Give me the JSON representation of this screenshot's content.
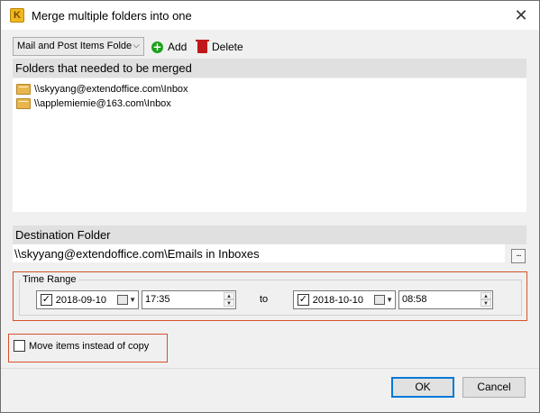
{
  "window": {
    "title": "Merge multiple folders into one"
  },
  "toolbar": {
    "folder_type_selected": "Mail and Post Items Folde",
    "add_label": "Add",
    "delete_label": "Delete"
  },
  "folders_section": {
    "heading": "Folders that needed to be merged",
    "items": [
      {
        "path": "\\\\skyyang@extendoffice.com\\Inbox"
      },
      {
        "path": "\\\\applemiemie@163.com\\Inbox"
      }
    ]
  },
  "destination": {
    "heading": "Destination Folder",
    "path": "\\\\skyyang@extendoffice.com\\Emails in Inboxes",
    "browse_label": "..."
  },
  "time_range": {
    "label": "Time Range",
    "from": {
      "checked": true,
      "date": "2018-09-10",
      "time": "17:35"
    },
    "to_label": "to",
    "to": {
      "checked": true,
      "date": "2018-10-10",
      "time": "08:58"
    }
  },
  "move_option": {
    "label": "Move items instead of copy",
    "checked": false
  },
  "buttons": {
    "ok": "OK",
    "cancel": "Cancel"
  },
  "colors": {
    "highlight": "#d2542a",
    "ok_border": "#0078d7"
  },
  "icons": {
    "app": "kutools-icon",
    "add": "plus-circle-icon",
    "delete": "trash-icon",
    "folder": "mail-folder-icon",
    "calendar": "calendar-icon"
  }
}
